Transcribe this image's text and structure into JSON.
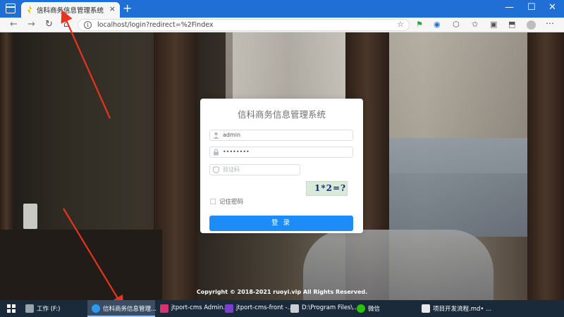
{
  "browser": {
    "tab_title": "信科商务信息管理系统",
    "tab_close": "×",
    "new_tab": "+",
    "url": "localhost/login?redirect=%2Findex",
    "window_buttons": {
      "minimize": "—",
      "maximize": "☐",
      "close": "✕"
    },
    "nav_buttons": {
      "back": "←",
      "forward": "→",
      "reload": "↻",
      "home": "⌂"
    },
    "toolbar_icons": [
      "read-aloud-icon",
      "extensions-icon",
      "favorites-icon",
      "collections-icon",
      "profile-icon",
      "menu-icon"
    ]
  },
  "login": {
    "title": "信科商务信息管理系统",
    "username": "admin",
    "password": "••••••••",
    "captcha_placeholder": "验证码",
    "captcha_text": "1*2=?",
    "remember_label": "记住密码",
    "submit_label": "登 录"
  },
  "footer": {
    "copyright": "Copyright © 2018-2021 ruoyi.vip All Rights Reserved."
  },
  "taskbar": {
    "items": [
      {
        "label": "工作 (F:)"
      },
      {
        "label": "信科商务信息管理..."
      },
      {
        "label": "jtport-cms Admin..."
      },
      {
        "label": "jtport-cms-front -..."
      },
      {
        "label": "D:\\Program Files\\..."
      },
      {
        "label": "微信"
      },
      {
        "label": "项目开发流程.md• ..."
      }
    ]
  },
  "colors": {
    "tabstrip": "#1f6fd6",
    "primary_button": "#1e8cf7",
    "annotation": "#e8331f",
    "taskbar": "#1b2a3a"
  }
}
